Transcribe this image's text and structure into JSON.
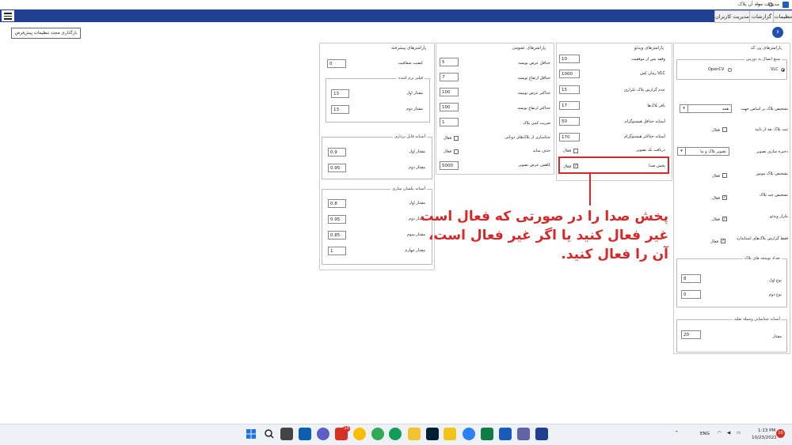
{
  "window": {
    "title": "مدیریت مواد آن پلاک",
    "controls": [
      "—",
      "⧉",
      "✕"
    ]
  },
  "menu": {
    "tabs": [
      "تنظیمات",
      "گزارشات",
      "مدیریت کاربران"
    ]
  },
  "toolbar": {
    "top_button": "بارگذاری مجدد تنظیمات پیش‌فرض",
    "nav_icon": "chevron-right-icon"
  },
  "advanced": {
    "title": "پارامترهای پیشرفته",
    "sharp_label": "کیفیت شفافیت",
    "sharp_value": "0",
    "normalize": {
      "title": "فیلتر نرم کننده",
      "rows": [
        {
          "label": "مقدار اول",
          "value": "13"
        },
        {
          "label": "مقدار دوم",
          "value": "13"
        }
      ]
    },
    "cutting": {
      "title": "آستانه قابل برداری",
      "rows": [
        {
          "label": "مقدار اول",
          "value": "0.9"
        },
        {
          "label": "مقدار دوم",
          "value": "0.95"
        }
      ]
    },
    "similarity": {
      "title": "آستانه یکسان سازی",
      "rows": [
        {
          "label": "مقدار اول",
          "value": "0.8"
        },
        {
          "label": "مقدار دوم",
          "value": "0.95"
        },
        {
          "label": "مقدار سوم",
          "value": "0.85"
        },
        {
          "label": "مقدار چهارم",
          "value": "1"
        }
      ]
    }
  },
  "general": {
    "title": "پارامترهای عمومی",
    "rows": [
      {
        "label": "حداقل عرض نویسه",
        "value": "5"
      },
      {
        "label": "حداقل ارتفاع نویسه",
        "value": "7"
      },
      {
        "label": "حداکثر عرض نویسه",
        "value": "100"
      },
      {
        "label": "حداکثر ارتفاع نویسه",
        "value": "100"
      },
      {
        "label": "ضریب کمی پلاک",
        "value": "1"
      }
    ],
    "checks": [
      {
        "label": "فعال",
        "caption": "جداسازی از پلاک‌های دوتایی"
      },
      {
        "label": "فعال",
        "caption": "حذف سایه"
      }
    ],
    "downscale_label": "کاهش عرض تصویر",
    "downscale_value": "5000"
  },
  "video": {
    "title": "پارامترهای ویدئو",
    "rows": [
      {
        "label": "وقفه پس از موفقیت",
        "value": "10"
      },
      {
        "label": "زمان کش VLC",
        "value": "1000"
      },
      {
        "label": "عدم گزارش پلاک تکراری",
        "value": "15"
      },
      {
        "label": "بافر پلاک‌ها",
        "value": "17"
      },
      {
        "label": "آستانه حداقل هیستوگرام",
        "value": "50"
      },
      {
        "label": "آستانه حداکثر هیستوگرام",
        "value": "170"
      }
    ],
    "single_image_label": "دریافت تک تصویر",
    "single_image_check": "فعال",
    "sound_label": "پخش صدا",
    "sound_check": "فعال"
  },
  "plate": {
    "title": "پارامترهای پی کد",
    "connection": {
      "title": "منبع اتصال به دوربین",
      "options": [
        "VLC",
        "OpenCV"
      ],
      "selected": "VLC"
    },
    "detect_label": "تشخیص پلاک بر اساس جهت",
    "detect_value": "همه",
    "checks": [
      {
        "caption": "ثبت پلاک بعد از تایید",
        "label": "فعال",
        "checked": false
      },
      {
        "caption": "تشخیص پلاک موتور",
        "label": "فعال",
        "checked": false
      },
      {
        "caption": "تشخیص چند پلاک",
        "label": "فعال",
        "checked": true
      },
      {
        "caption": "تکرار ویدئو",
        "label": "فعال",
        "checked": true
      },
      {
        "caption": "فقط گزارش پلاک‌های استاندارد",
        "label": "فعال",
        "checked": true
      }
    ],
    "save_label": "ذخیره سازی تصویر",
    "save_value": "تصویر پلاک و ما",
    "count": {
      "title": "تعداد توسعه های پلاک",
      "rows": [
        {
          "label": "نوع اول",
          "value": "8"
        },
        {
          "label": "نوع دوم",
          "value": "0"
        }
      ]
    },
    "threshold": {
      "title": "آستانه شناسایی وسیله نقلیه",
      "rows": [
        {
          "label": "مقدار",
          "value": "20"
        }
      ]
    }
  },
  "callout": {
    "lines": [
      "پخش صدا را در صورتی که فعال است",
      "غیر فعال کنید یا اگر غیر فعال است،",
      "آن را فعال کنید."
    ],
    "color": "#d62828"
  },
  "tray": {
    "lang": "ENG",
    "time": "1:13 PM",
    "date": "10/23/2021",
    "badge": "10",
    "app_badge": "10"
  }
}
